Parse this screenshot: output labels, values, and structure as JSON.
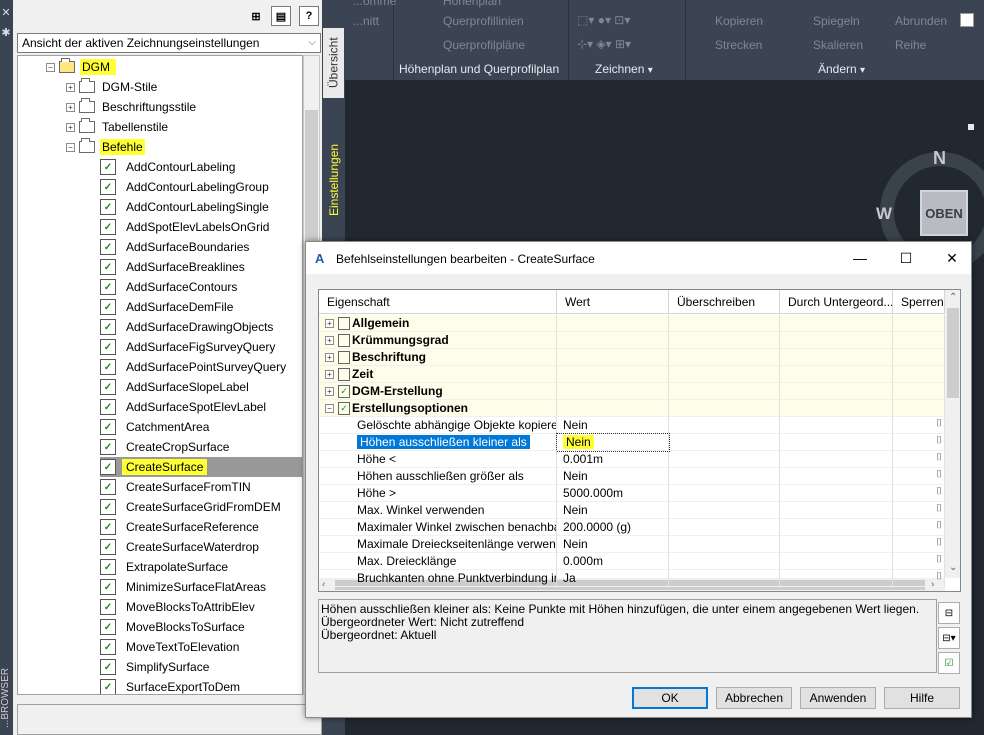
{
  "ribbon": {
    "items": [
      "...omme",
      "...nitt",
      "Höhenplan",
      "Querprofillinien",
      "Querprofilpläne",
      "Kopieren",
      "Spiegeln",
      "Abrunden",
      "Strecken",
      "Skalieren",
      "Reihe"
    ],
    "panels": {
      "profile": "Höhenplan und Querprofilplan",
      "draw": "Zeichnen",
      "modify": "Ändern"
    }
  },
  "viewport": {
    "compass_n": "N",
    "compass_w": "W",
    "cube_label": "OBEN"
  },
  "palette": {
    "view_select": "Ansicht der aktiven Zeichnungseinstellungen",
    "vtab_overview": "Übersicht",
    "vtab_settings": "Einstellungen",
    "side_title": "...BROWSER",
    "tree": {
      "root": "DGM",
      "folders": [
        "DGM-Stile",
        "Beschriftungsstile",
        "Tabellenstile",
        "Befehle"
      ],
      "commands": [
        "AddContourLabeling",
        "AddContourLabelingGroup",
        "AddContourLabelingSingle",
        "AddSpotElevLabelsOnGrid",
        "AddSurfaceBoundaries",
        "AddSurfaceBreaklines",
        "AddSurfaceContours",
        "AddSurfaceDemFile",
        "AddSurfaceDrawingObjects",
        "AddSurfaceFigSurveyQuery",
        "AddSurfacePointSurveyQuery",
        "AddSurfaceSlopeLabel",
        "AddSurfaceSpotElevLabel",
        "CatchmentArea",
        "CreateCropSurface",
        "CreateSurface",
        "CreateSurfaceFromTIN",
        "CreateSurfaceGridFromDEM",
        "CreateSurfaceReference",
        "CreateSurfaceWaterdrop",
        "ExtrapolateSurface",
        "MinimizeSurfaceFlatAreas",
        "MoveBlocksToAttribElev",
        "MoveBlocksToSurface",
        "MoveTextToElevation",
        "SimplifySurface",
        "SurfaceExportToDem"
      ],
      "selected": "CreateSurface"
    }
  },
  "dialog": {
    "title": "Befehlseinstellungen bearbeiten - CreateSurface",
    "columns": [
      "Eigenschaft",
      "Wert",
      "Überschreiben",
      "Durch Untergeord...",
      "Sperren"
    ],
    "categories": [
      "Allgemein",
      "Krümmungsgrad",
      "Beschriftung",
      "Zeit",
      "DGM-Erstellung",
      "Erstellungsoptionen"
    ],
    "rows": [
      {
        "prop": "Gelöschte abhängige Objekte kopieren",
        "value": "Nein"
      },
      {
        "prop": "Höhen ausschließen kleiner als",
        "value": "Nein"
      },
      {
        "prop": "Höhe <",
        "value": "0.001m"
      },
      {
        "prop": "Höhen ausschließen größer als",
        "value": "Nein"
      },
      {
        "prop": "Höhe >",
        "value": "5000.000m"
      },
      {
        "prop": "Max. Winkel verwenden",
        "value": "Nein"
      },
      {
        "prop": "Maximaler Winkel zwischen benachbart...",
        "value": "200.0000 (g)"
      },
      {
        "prop": "Maximale Dreieckseitenlänge verwenden",
        "value": "Nein"
      },
      {
        "prop": "Max. Dreiecklänge",
        "value": "0.000m"
      },
      {
        "prop": "Bruchkanten ohne Punktverbindung in...",
        "value": "Ja"
      }
    ],
    "description": [
      "Höhen ausschließen kleiner als: Keine Punkte mit Höhen hinzufügen, die unter einem angegebenen Wert liegen.",
      "Übergeordneter Wert: Nicht zutreffend",
      "Übergeordnet: Aktuell"
    ],
    "buttons": {
      "ok": "OK",
      "cancel": "Abbrechen",
      "apply": "Anwenden",
      "help": "Hilfe"
    }
  },
  "colors": {
    "highlight": "#ffff33",
    "selection": "#999999",
    "ribbon": "#3b4453"
  }
}
